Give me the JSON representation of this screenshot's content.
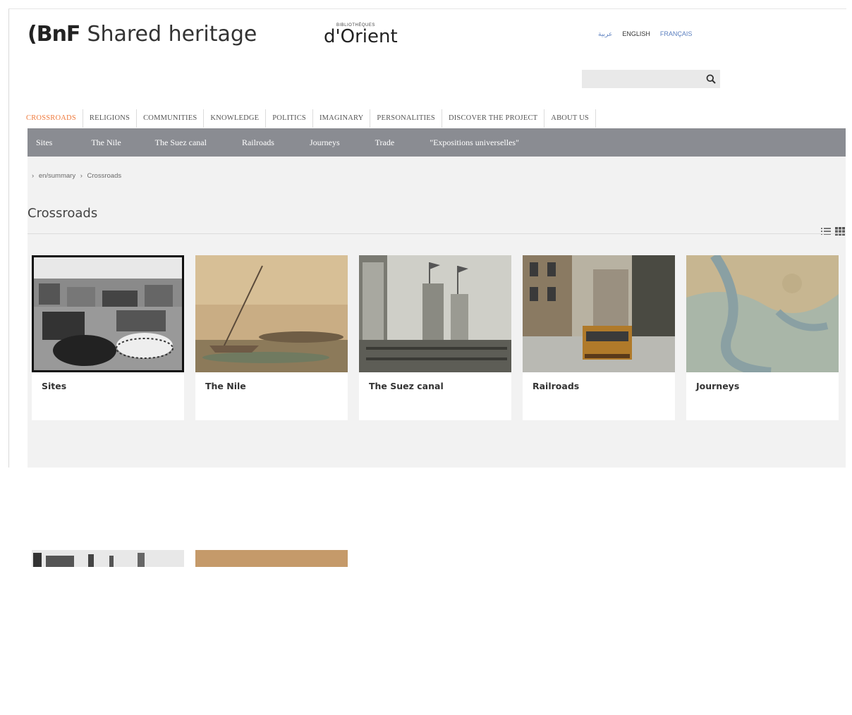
{
  "header": {
    "logo_mark": "(BnF",
    "logo_title": "Shared heritage",
    "partner_small": "BIBLIOTHÈQUES",
    "partner_big": "d'Orient"
  },
  "languages": [
    {
      "label": "عربية"
    },
    {
      "label": "ENGLISH"
    },
    {
      "label": "FRANÇAIS"
    }
  ],
  "search": {
    "placeholder": "",
    "value": "",
    "icon": "search-icon"
  },
  "main_nav": [
    {
      "label": "CROSSROADS",
      "active": true
    },
    {
      "label": "RELIGIONS"
    },
    {
      "label": "COMMUNITIES"
    },
    {
      "label": "KNOWLEDGE"
    },
    {
      "label": "POLITICS"
    },
    {
      "label": "IMAGINARY"
    },
    {
      "label": "PERSONALITIES"
    },
    {
      "label": "DISCOVER THE PROJECT"
    },
    {
      "label": "ABOUT US"
    }
  ],
  "sub_nav": [
    {
      "label": "Sites"
    },
    {
      "label": "The Nile"
    },
    {
      "label": "The Suez canal"
    },
    {
      "label": "Railroads"
    },
    {
      "label": "Journeys"
    },
    {
      "label": "Trade"
    },
    {
      "label": "\"Expositions universelles\""
    }
  ],
  "breadcrumb": {
    "sep": "›",
    "path": "en/summary",
    "dash": "›",
    "current": "Crossroads"
  },
  "page_title": "Crossroads",
  "view_toggle": {
    "list_icon": "list-view-icon",
    "grid_icon": "grid-view-icon"
  },
  "cards": [
    {
      "label": "Sites"
    },
    {
      "label": "The Nile"
    },
    {
      "label": "The Suez canal"
    },
    {
      "label": "Railroads"
    },
    {
      "label": "Journeys"
    }
  ],
  "colors": {
    "accent": "#ef7a3c",
    "subnav_bg": "#8a8c92",
    "content_bg": "#f2f2f2",
    "link_blue": "#5b7fbf"
  }
}
